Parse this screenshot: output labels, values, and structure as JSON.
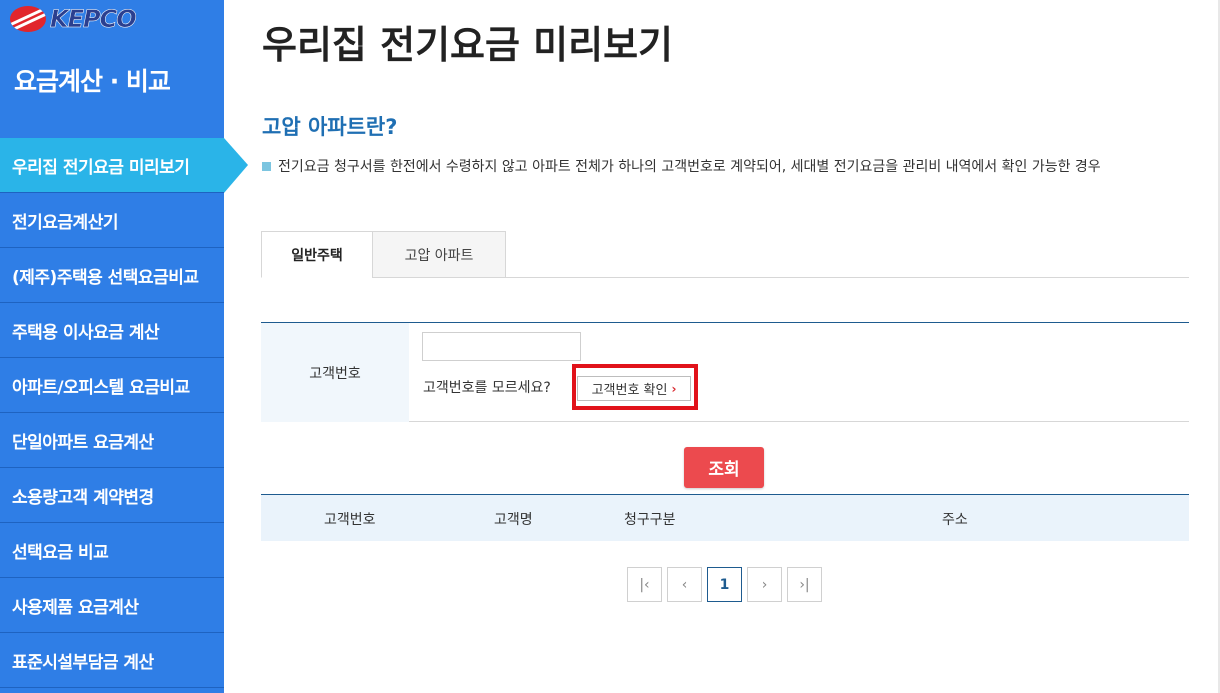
{
  "logo": {
    "text": "KEPCO"
  },
  "sidebar": {
    "title": "요금계산 · 비교",
    "items": [
      {
        "label": "우리집 전기요금 미리보기",
        "active": true
      },
      {
        "label": "전기요금계산기",
        "active": false
      },
      {
        "label": "(제주)주택용 선택요금비교",
        "active": false
      },
      {
        "label": "주택용 이사요금 계산",
        "active": false
      },
      {
        "label": "아파트/오피스텔 요금비교",
        "active": false
      },
      {
        "label": "단일아파트 요금계산",
        "active": false
      },
      {
        "label": "소용량고객 계약변경",
        "active": false
      },
      {
        "label": "선택요금 비교",
        "active": false
      },
      {
        "label": "사용제품 요금계산",
        "active": false
      },
      {
        "label": "표준시설부담금 계산",
        "active": false
      }
    ]
  },
  "main": {
    "page_title": "우리집 전기요금 미리보기",
    "section_title": "고압 아파트란?",
    "description": "전기요금 청구서를 한전에서 수령하지 않고 아파트 전체가 하나의 고객번호로 계약되어, 세대별 전기요금을 관리비 내역에서 확인 가능한 경우",
    "tabs": [
      {
        "label": "일반주택",
        "active": true
      },
      {
        "label": "고압 아파트",
        "active": false
      }
    ],
    "form": {
      "customer_number_label": "고객번호",
      "customer_number_value": "",
      "unknown_text": "고객번호를 모르세요?",
      "confirm_button": "고객번호 확인",
      "confirm_chevron": "›"
    },
    "search_button": "조회",
    "result_columns": [
      "고객번호",
      "고객명",
      "청구구분",
      "주소"
    ],
    "pagination": {
      "first": "|‹",
      "prev": "‹",
      "current_page": "1",
      "next": "›",
      "last": "›|"
    }
  },
  "colors": {
    "sidebar_bg": "#2f7ee6",
    "sidebar_active": "#2ab4e8",
    "section_title": "#1f6fb3",
    "search_button": "#ec4a4e",
    "highlight": "#e1121a"
  }
}
